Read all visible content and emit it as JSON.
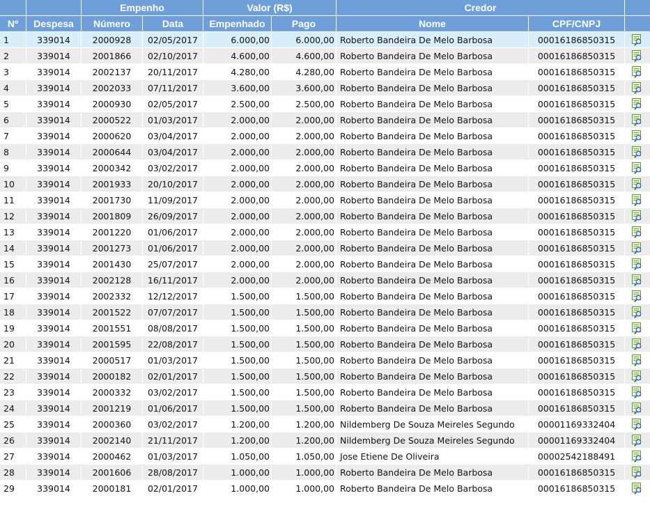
{
  "headers": {
    "empenho": "Empenho",
    "valor": "Valor (R$)",
    "credor": "Credor",
    "no": "Nº",
    "despesa": "Despesa",
    "numero": "Número",
    "data": "Data",
    "empenhado": "Empenhado",
    "pago": "Pago",
    "nome": "Nome",
    "cpf": "CPF/CNPJ"
  },
  "colors": {
    "header_bg": "#6f9fd8",
    "row_alt": "#ececec",
    "row_selected": "#d9eefb"
  },
  "row_icon": "document-magnifier-icon",
  "rows": [
    {
      "no": "1",
      "despesa": "339014",
      "numero": "2000928",
      "data": "02/05/2017",
      "empenhado": "6.000,00",
      "pago": "6.000,00",
      "nome": "Roberto Bandeira De Melo Barbosa",
      "cpf": "00016186850315"
    },
    {
      "no": "2",
      "despesa": "339014",
      "numero": "2001866",
      "data": "02/10/2017",
      "empenhado": "4.600,00",
      "pago": "4.600,00",
      "nome": "Roberto Bandeira De Melo Barbosa",
      "cpf": "00016186850315"
    },
    {
      "no": "3",
      "despesa": "339014",
      "numero": "2002137",
      "data": "20/11/2017",
      "empenhado": "4.280,00",
      "pago": "4.280,00",
      "nome": "Roberto Bandeira De Melo Barbosa",
      "cpf": "00016186850315"
    },
    {
      "no": "4",
      "despesa": "339014",
      "numero": "2002033",
      "data": "07/11/2017",
      "empenhado": "3.600,00",
      "pago": "3.600,00",
      "nome": "Roberto Bandeira De Melo Barbosa",
      "cpf": "00016186850315"
    },
    {
      "no": "5",
      "despesa": "339014",
      "numero": "2000930",
      "data": "02/05/2017",
      "empenhado": "2.500,00",
      "pago": "2.500,00",
      "nome": "Roberto Bandeira De Melo Barbosa",
      "cpf": "00016186850315"
    },
    {
      "no": "6",
      "despesa": "339014",
      "numero": "2000522",
      "data": "01/03/2017",
      "empenhado": "2.000,00",
      "pago": "2.000,00",
      "nome": "Roberto Bandeira De Melo Barbosa",
      "cpf": "00016186850315"
    },
    {
      "no": "7",
      "despesa": "339014",
      "numero": "2000620",
      "data": "03/04/2017",
      "empenhado": "2.000,00",
      "pago": "2.000,00",
      "nome": "Roberto Bandeira De Melo Barbosa",
      "cpf": "00016186850315"
    },
    {
      "no": "8",
      "despesa": "339014",
      "numero": "2000644",
      "data": "03/04/2017",
      "empenhado": "2.000,00",
      "pago": "2.000,00",
      "nome": "Roberto Bandeira De Melo Barbosa",
      "cpf": "00016186850315"
    },
    {
      "no": "9",
      "despesa": "339014",
      "numero": "2000342",
      "data": "03/02/2017",
      "empenhado": "2.000,00",
      "pago": "2.000,00",
      "nome": "Roberto Bandeira De Melo Barbosa",
      "cpf": "00016186850315"
    },
    {
      "no": "10",
      "despesa": "339014",
      "numero": "2001933",
      "data": "20/10/2017",
      "empenhado": "2.000,00",
      "pago": "2.000,00",
      "nome": "Roberto Bandeira De Melo Barbosa",
      "cpf": "00016186850315"
    },
    {
      "no": "11",
      "despesa": "339014",
      "numero": "2001730",
      "data": "11/09/2017",
      "empenhado": "2.000,00",
      "pago": "2.000,00",
      "nome": "Roberto Bandeira De Melo Barbosa",
      "cpf": "00016186850315"
    },
    {
      "no": "12",
      "despesa": "339014",
      "numero": "2001809",
      "data": "26/09/2017",
      "empenhado": "2.000,00",
      "pago": "2.000,00",
      "nome": "Roberto Bandeira De Melo Barbosa",
      "cpf": "00016186850315"
    },
    {
      "no": "13",
      "despesa": "339014",
      "numero": "2001220",
      "data": "01/06/2017",
      "empenhado": "2.000,00",
      "pago": "2.000,00",
      "nome": "Roberto Bandeira De Melo Barbosa",
      "cpf": "00016186850315"
    },
    {
      "no": "14",
      "despesa": "339014",
      "numero": "2001273",
      "data": "01/06/2017",
      "empenhado": "2.000,00",
      "pago": "2.000,00",
      "nome": "Roberto Bandeira De Melo Barbosa",
      "cpf": "00016186850315"
    },
    {
      "no": "15",
      "despesa": "339014",
      "numero": "2001430",
      "data": "25/07/2017",
      "empenhado": "2.000,00",
      "pago": "2.000,00",
      "nome": "Roberto Bandeira De Melo Barbosa",
      "cpf": "00016186850315"
    },
    {
      "no": "16",
      "despesa": "339014",
      "numero": "2002128",
      "data": "16/11/2017",
      "empenhado": "2.000,00",
      "pago": "2.000,00",
      "nome": "Roberto Bandeira De Melo Barbosa",
      "cpf": "00016186850315"
    },
    {
      "no": "17",
      "despesa": "339014",
      "numero": "2002332",
      "data": "12/12/2017",
      "empenhado": "1.500,00",
      "pago": "1.500,00",
      "nome": "Roberto Bandeira De Melo Barbosa",
      "cpf": "00016186850315"
    },
    {
      "no": "18",
      "despesa": "339014",
      "numero": "2001522",
      "data": "07/07/2017",
      "empenhado": "1.500,00",
      "pago": "1.500,00",
      "nome": "Roberto Bandeira De Melo Barbosa",
      "cpf": "00016186850315"
    },
    {
      "no": "19",
      "despesa": "339014",
      "numero": "2001551",
      "data": "08/08/2017",
      "empenhado": "1.500,00",
      "pago": "1.500,00",
      "nome": "Roberto Bandeira De Melo Barbosa",
      "cpf": "00016186850315"
    },
    {
      "no": "20",
      "despesa": "339014",
      "numero": "2001595",
      "data": "22/08/2017",
      "empenhado": "1.500,00",
      "pago": "1.500,00",
      "nome": "Roberto Bandeira De Melo Barbosa",
      "cpf": "00016186850315"
    },
    {
      "no": "21",
      "despesa": "339014",
      "numero": "2000517",
      "data": "01/03/2017",
      "empenhado": "1.500,00",
      "pago": "1.500,00",
      "nome": "Roberto Bandeira De Melo Barbosa",
      "cpf": "00016186850315"
    },
    {
      "no": "22",
      "despesa": "339014",
      "numero": "2000182",
      "data": "02/01/2017",
      "empenhado": "1.500,00",
      "pago": "1.500,00",
      "nome": "Roberto Bandeira De Melo Barbosa",
      "cpf": "00016186850315"
    },
    {
      "no": "23",
      "despesa": "339014",
      "numero": "2000332",
      "data": "03/02/2017",
      "empenhado": "1.500,00",
      "pago": "1.500,00",
      "nome": "Roberto Bandeira De Melo Barbosa",
      "cpf": "00016186850315"
    },
    {
      "no": "24",
      "despesa": "339014",
      "numero": "2001219",
      "data": "01/06/2017",
      "empenhado": "1.500,00",
      "pago": "1.500,00",
      "nome": "Roberto Bandeira De Melo Barbosa",
      "cpf": "00016186850315"
    },
    {
      "no": "25",
      "despesa": "339014",
      "numero": "2000360",
      "data": "03/02/2017",
      "empenhado": "1.200,00",
      "pago": "1.200,00",
      "nome": "Nildemberg De Souza Meireles Segundo",
      "cpf": "00001169332404"
    },
    {
      "no": "26",
      "despesa": "339014",
      "numero": "2002140",
      "data": "21/11/2017",
      "empenhado": "1.200,00",
      "pago": "1.200,00",
      "nome": "Nildemberg De Souza Meireles Segundo",
      "cpf": "00001169332404"
    },
    {
      "no": "27",
      "despesa": "339014",
      "numero": "2000462",
      "data": "01/03/2017",
      "empenhado": "1.050,00",
      "pago": "1.050,00",
      "nome": "Jose Etiene De Oliveira",
      "cpf": "00002542188491"
    },
    {
      "no": "28",
      "despesa": "339014",
      "numero": "2001606",
      "data": "28/08/2017",
      "empenhado": "1.000,00",
      "pago": "1.000,00",
      "nome": "Roberto Bandeira De Melo Barbosa",
      "cpf": "00016186850315"
    },
    {
      "no": "29",
      "despesa": "339014",
      "numero": "2000181",
      "data": "02/01/2017",
      "empenhado": "1.000,00",
      "pago": "1.000,00",
      "nome": "Roberto Bandeira De Melo Barbosa",
      "cpf": "00016186850315"
    }
  ]
}
